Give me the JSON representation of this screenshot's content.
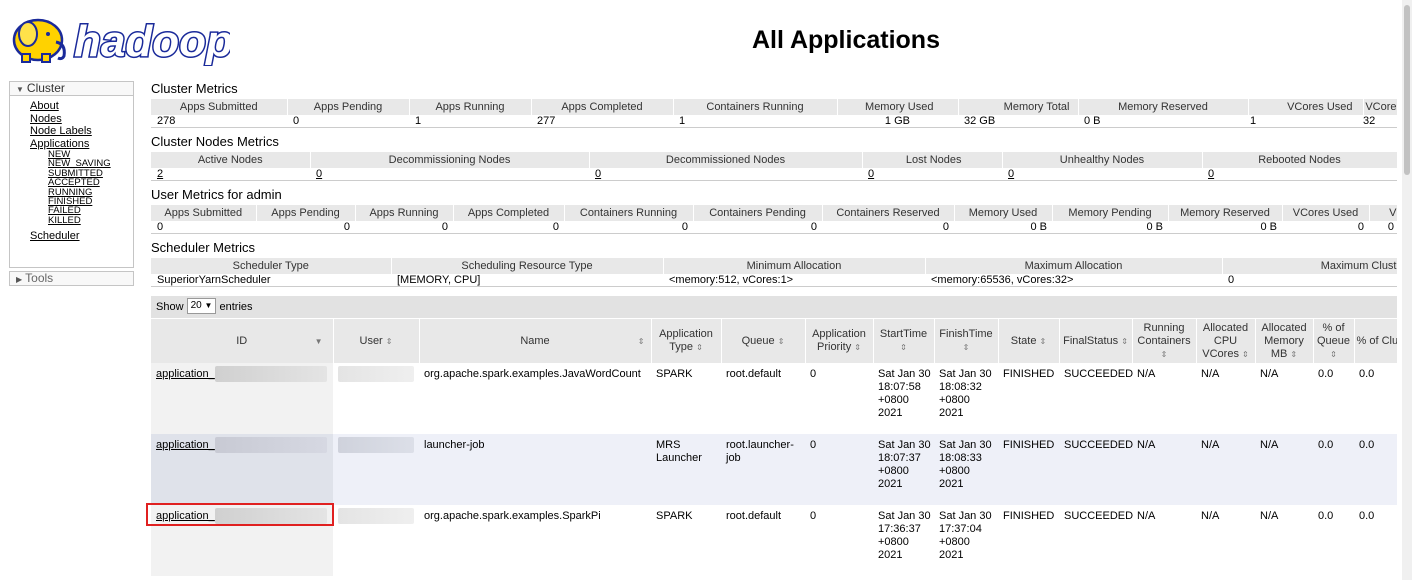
{
  "logo_text": "hadoop",
  "page_title": "All Applications",
  "nav": {
    "cluster_label": "Cluster",
    "links": [
      "About",
      "Nodes",
      "Node Labels",
      "Applications"
    ],
    "app_states": [
      "NEW",
      "NEW_SAVING",
      "SUBMITTED",
      "ACCEPTED",
      "RUNNING",
      "FINISHED",
      "FAILED",
      "KILLED"
    ],
    "scheduler_label": "Scheduler",
    "tools_label": "Tools"
  },
  "cluster_metrics": {
    "title": "Cluster Metrics",
    "headers": [
      "Apps Submitted",
      "Apps Pending",
      "Apps Running",
      "Apps Completed",
      "Containers Running",
      "Memory Used",
      "Memory Total",
      "Memory Reserved",
      "VCores Used",
      "VCore"
    ],
    "values": [
      "278",
      "0",
      "1",
      "277",
      "1",
      "1 GB",
      "32 GB",
      "0 B",
      "1",
      "32"
    ]
  },
  "nodes_metrics": {
    "title": "Cluster Nodes Metrics",
    "headers": [
      "Active Nodes",
      "Decommissioning Nodes",
      "Decommissioned Nodes",
      "Lost Nodes",
      "Unhealthy Nodes",
      "Rebooted Nodes"
    ],
    "values": [
      "2",
      "0",
      "0",
      "0",
      "0",
      "0"
    ]
  },
  "user_metrics": {
    "title": "User Metrics for admin",
    "headers": [
      "Apps Submitted",
      "Apps Pending",
      "Apps Running",
      "Apps Completed",
      "Containers Running",
      "Containers Pending",
      "Containers Reserved",
      "Memory Used",
      "Memory Pending",
      "Memory Reserved",
      "VCores Used",
      "V"
    ],
    "values": [
      "0",
      "0",
      "0",
      "0",
      "0",
      "0",
      "0",
      "0 B",
      "0 B",
      "0 B",
      "0",
      "0"
    ]
  },
  "scheduler_metrics": {
    "title": "Scheduler Metrics",
    "headers": [
      "Scheduler Type",
      "Scheduling Resource Type",
      "Minimum Allocation",
      "Maximum Allocation",
      "Maximum Clust"
    ],
    "values": [
      "SuperiorYarnScheduler",
      "[MEMORY, CPU]",
      "<memory:512, vCores:1>",
      "<memory:65536, vCores:32>",
      "0"
    ]
  },
  "show_entries": {
    "prefix": "Show",
    "value": "20",
    "suffix": "entries"
  },
  "apps_table": {
    "headers": [
      "ID",
      "User",
      "Name",
      "Application Type",
      "Queue",
      "Application Priority",
      "StartTime",
      "FinishTime",
      "State",
      "FinalStatus",
      "Running Containers",
      "Allocated CPU VCores",
      "Allocated Memory MB",
      "% of Queue",
      "% of Cluster"
    ],
    "rows": [
      {
        "id": "application_",
        "name": "org.apache.spark.examples.JavaWordCount",
        "type": "SPARK",
        "queue": "root.default",
        "priority": "0",
        "start": "Sat Jan 30 18:07:58 +0800 2021",
        "finish": "Sat Jan 30 18:08:32 +0800 2021",
        "state": "FINISHED",
        "final_status": "SUCCEEDED",
        "running": "N/A",
        "cpu": "N/A",
        "mem": "N/A",
        "pct_queue": "0.0",
        "pct_cluster": "0.0"
      },
      {
        "id": "application_",
        "name": "launcher-job",
        "type": "MRS Launcher",
        "queue": "root.launcher-job",
        "priority": "0",
        "start": "Sat Jan 30 18:07:37 +0800 2021",
        "finish": "Sat Jan 30 18:08:33 +0800 2021",
        "state": "FINISHED",
        "final_status": "SUCCEEDED",
        "running": "N/A",
        "cpu": "N/A",
        "mem": "N/A",
        "pct_queue": "0.0",
        "pct_cluster": "0.0"
      },
      {
        "id": "application_",
        "name": "org.apache.spark.examples.SparkPi",
        "type": "SPARK",
        "queue": "root.default",
        "priority": "0",
        "start": "Sat Jan 30 17:36:37 +0800 2021",
        "finish": "Sat Jan 30 17:37:04 +0800 2021",
        "state": "FINISHED",
        "final_status": "SUCCEEDED",
        "running": "N/A",
        "cpu": "N/A",
        "mem": "N/A",
        "pct_queue": "0.0",
        "pct_cluster": "0.0"
      }
    ]
  },
  "colors": {
    "highlight": "#e02020",
    "logo_blue": "#1a2a9a",
    "logo_yellow": "#ffd200"
  }
}
